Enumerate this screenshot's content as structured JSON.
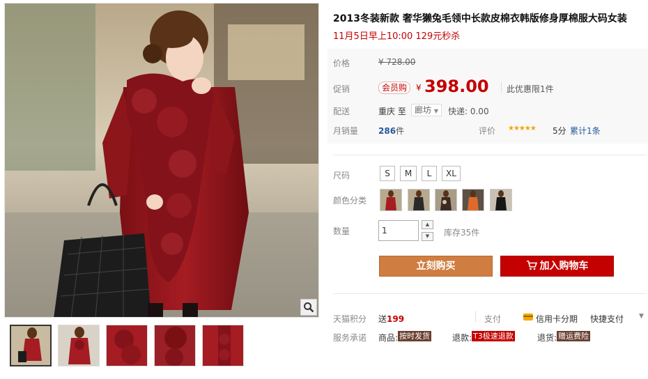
{
  "product": {
    "title": "2013冬装新款 奢华獭兔毛领中长款皮棉衣韩版修身厚棉服大码女装",
    "promo_line": "11月5日早上10:00 129元秒杀"
  },
  "gallery": {
    "zoom_icon": "magnifier-icon",
    "thumbnails": [
      "thumb-full-body",
      "thumb-bag-pose",
      "thumb-fur-collar",
      "thumb-fur-closeup",
      "thumb-fur-detail"
    ]
  },
  "pricing": {
    "price_label": "价格",
    "original_price": "¥ 728.00",
    "promo_label": "促销",
    "member_tag": "会员购",
    "currency": "¥",
    "current_price": "398.00",
    "limit_text": "此优惠限1件"
  },
  "shipping": {
    "label": "配送",
    "from_to": "重庆 至",
    "destination": "廊坊",
    "fee": "快递: 0.00"
  },
  "sales": {
    "label": "月销量",
    "count": "286",
    "unit": "件",
    "review_label": "评价",
    "stars": "★★★★★",
    "score": "5分",
    "review_count": "累计1条"
  },
  "options": {
    "size_label": "尺码",
    "sizes": [
      "S",
      "M",
      "L",
      "XL"
    ],
    "color_label": "颜色分类",
    "color_swatches": [
      "swatch-red",
      "swatch-dark",
      "swatch-print",
      "swatch-orange",
      "swatch-black"
    ],
    "qty_label": "数量",
    "qty_value": "1",
    "stepper_up": "▲",
    "stepper_down": "▼",
    "stock": "库存35件"
  },
  "actions": {
    "buy_now": "立刻购买",
    "add_cart": "加入购物车",
    "cart_icon": "shopping-cart-icon"
  },
  "benefits": {
    "points_label": "天猫积分",
    "points_prefix": "送",
    "points_value": "199",
    "pay_label": "支付",
    "card_text": "信用卡分期",
    "fast_pay": "快捷支付",
    "fast_arrow": "▼",
    "service_label": "服务承诺",
    "goods_label": "商品:",
    "goods_badge": "按时发货",
    "refund_label": "退款:",
    "refund_badge": "T3极速退款",
    "return_label": "退货:",
    "return_badge": "赠运费险"
  },
  "colors": {
    "price_red": "#c40000",
    "buy_orange": "#cf7d41",
    "link_blue": "#225a9c",
    "star_gold": "#f5a300"
  }
}
